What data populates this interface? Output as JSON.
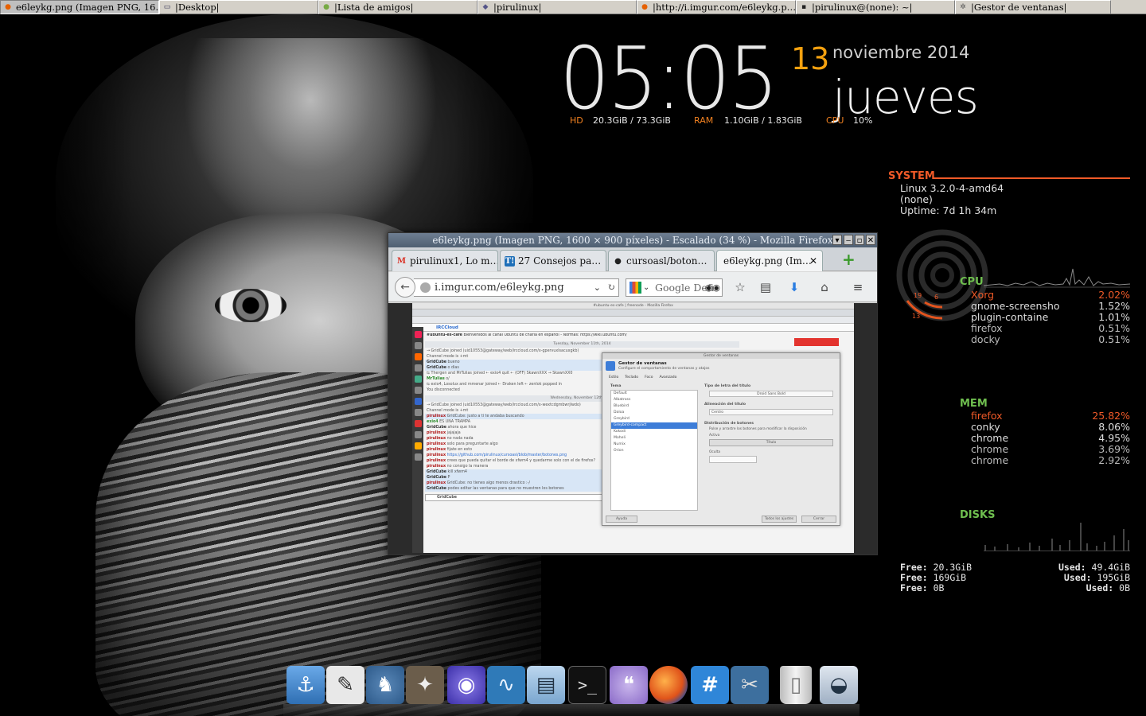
{
  "taskbar": {
    "tasks": [
      {
        "label": "e6leykg.png (Imagen PNG, 16…",
        "icon": "firefox-icon",
        "active": true
      },
      {
        "label": "|Desktop|",
        "icon": "window-icon"
      },
      {
        "label": "|Lista de amigos|",
        "icon": "pidgin-icon"
      },
      {
        "label": "|pirulinux|",
        "icon": "chat-icon"
      },
      {
        "label": "|http://i.imgur.com/e6leykg.p…",
        "icon": "firefox-icon"
      },
      {
        "label": "|pirulinux@(none): ~|",
        "icon": "terminal-icon"
      },
      {
        "label": "|Gestor de ventanas|",
        "icon": "settings-icon"
      }
    ]
  },
  "clock": {
    "time": "05:05",
    "day_number": "13",
    "month_year": "noviembre 2014",
    "weekday": "jueves"
  },
  "stats": {
    "hd_label": "HD",
    "hd_value": "20.3GiB / 73.3GiB",
    "ram_label": "RAM",
    "ram_value": "1.10GiB / 1.83GiB",
    "cpu_label": "CPU",
    "cpu_value": "10%"
  },
  "system": {
    "heading": "SYSTEM",
    "kernel": "Linux 3.2.0-4-amd64",
    "host": "(none)",
    "uptime": "Uptime: 7d 1h 34m",
    "ring_values": [
      "19",
      "6",
      "13"
    ]
  },
  "cpu": {
    "heading": "CPU",
    "processes": [
      {
        "name": "Xorg",
        "value": "2.02%"
      },
      {
        "name": "gnome-screensho",
        "value": "1.52%"
      },
      {
        "name": "plugin-containe",
        "value": "1.01%"
      },
      {
        "name": "firefox",
        "value": "0.51%"
      },
      {
        "name": "docky",
        "value": "0.51%"
      }
    ]
  },
  "mem": {
    "heading": "MEM",
    "processes": [
      {
        "name": "firefox",
        "value": "25.82%"
      },
      {
        "name": "conky",
        "value": "8.06%"
      },
      {
        "name": "chrome",
        "value": "4.95%"
      },
      {
        "name": "chrome",
        "value": "3.69%"
      },
      {
        "name": "chrome",
        "value": "2.92%"
      }
    ]
  },
  "disks": {
    "heading": "DISKS",
    "free_label": "Free:",
    "used_label": "Used:",
    "rows": [
      {
        "free": "20.3GiB",
        "used": "49.4GiB"
      },
      {
        "free": "169GiB",
        "used": "195GiB"
      },
      {
        "free": "0B",
        "used": "0B"
      }
    ]
  },
  "firefox": {
    "title": "e6leykg.png (Imagen PNG, 1600 × 900 píxeles) - Escalado (34 %) - Mozilla Firefox",
    "tabs": [
      {
        "label": "pirulinux1, Lo m…",
        "icon": "gmail-icon"
      },
      {
        "label": "27 Consejos pa…",
        "icon": "trello-icon"
      },
      {
        "label": "cursoasl/boton…",
        "icon": "github-icon"
      },
      {
        "label": "e6leykg.png (Im…",
        "icon": "image-icon",
        "selected": true
      }
    ],
    "url": "i.imgur.com/e6leykg.png",
    "search_placeholder": "Google Defi"
  },
  "inner_screenshot": {
    "window_title": "#ubuntu-es-cafe | freenode - Mozilla Firefox",
    "app_name": "IRCCloud",
    "channel": "#ubuntu-es-cafe",
    "topic": "Bienvenidos al canal Ubuntu de charla en español - Normas: https://wiki.ubuntu.com/",
    "date1": "Tuesday, November 11th, 2014",
    "date2": "Wednesday, November 12th, 2014",
    "lines": [
      {
        "nick": "",
        "text": "→ GridCube joined (uid10553@gateway/web/irccloud.com/x-gpervuxlsacuxgkb)"
      },
      {
        "nick": "",
        "text": "Channel mode is +mt"
      },
      {
        "nick": "GridCube",
        "text": "bueno"
      },
      {
        "nick": "GridCube",
        "text": "o dias"
      },
      {
        "nick": "",
        "text": "⇆ Thergen and MrTulias joined ⇠ exio4 quit ⇠ (OFF) SkawnXXX → SkawnXX0"
      },
      {
        "nick": "MrTulias",
        "text": "o/"
      },
      {
        "nick": "",
        "text": "⇆ exio4, Losolux and mmenar joined ⇠ Draken left ⇠ zenlok popped in"
      },
      {
        "nick": "",
        "text": "You disconnected"
      },
      {
        "nick": "",
        "text": "→ GridCube joined (uid10553@gateway/web/irccloud.com/x-wextcdgmbwrjlwdo)"
      },
      {
        "nick": "",
        "text": "Channel mode is +mt"
      },
      {
        "nick": "pirulinux",
        "text": "GridCube: justo a ti te andaba buscando"
      },
      {
        "nick": "exio4",
        "text": "ES UNA TRAMPA"
      },
      {
        "nick": "GridCube",
        "text": "ahora que hice"
      },
      {
        "nick": "pirulinux",
        "text": "jajajaja"
      },
      {
        "nick": "pirulinux",
        "text": "no nada nada"
      },
      {
        "nick": "pirulinux",
        "text": "solo para preguntarte algo"
      },
      {
        "nick": "pirulinux",
        "text": "fijate en esto"
      },
      {
        "nick": "pirulinux",
        "text": "https://github.com/pirulinux/cursoasl/blob/master/botones.png"
      },
      {
        "nick": "pirulinux",
        "text": "crees que pueda quitar el borde de xfwm4 y quedarme solo con el de firefox?"
      },
      {
        "nick": "pirulinux",
        "text": "no consigo la manera"
      },
      {
        "nick": "GridCube",
        "text": "kill xfwm4"
      },
      {
        "nick": "GridCube",
        "text": "P"
      },
      {
        "nick": "pirulinux",
        "text": "GridCube: no tienes algo menos drastico :-/"
      },
      {
        "nick": "GridCube",
        "text": "podes editar las ventanas para que no muestren los botones"
      }
    ],
    "input_nick": "GridCube",
    "dialog": {
      "title": "Gestor de ventanas",
      "heading": "Gestor de ventanas",
      "subheading": "Configure el comportamiento de ventanas y atajos",
      "tabs": [
        "Estilo",
        "Teclado",
        "Foco",
        "Avanzado"
      ],
      "theme_label": "Tema",
      "themes": [
        "Default",
        "Albatross",
        "Bluebird",
        "Daloa",
        "Greybird",
        "Greybird-compact",
        "Kokodi",
        "Moheli",
        "Numix",
        "Orion"
      ],
      "selected_theme": "Greybird-compact",
      "font_label": "Tipo de letra del título",
      "font_value": "Droid Sans Bold",
      "align_label": "Alineación del título",
      "align_value": "Centro",
      "buttons_label": "Distribución de botones",
      "buttons_hint": "Pulse y arrastre los botones para modificar la disposición",
      "active_label": "Activa",
      "title_field": "Título",
      "hidden_label": "Oculta",
      "help_button": "Ayuda",
      "all_settings_button": "Todos los ajustes",
      "close_button": "Cerrar"
    }
  },
  "dock": {
    "icons": [
      "anchor-icon",
      "text-editor-icon",
      "postgresql-icon",
      "gimp-icon",
      "pidgin-icon",
      "system-monitor-icon",
      "file-cabinet-icon",
      "terminal-icon",
      "chat-bubble-icon",
      "firefox-icon",
      "hashtag-icon",
      "settings-tools-icon",
      "trash-icon",
      "lock-icon"
    ]
  }
}
